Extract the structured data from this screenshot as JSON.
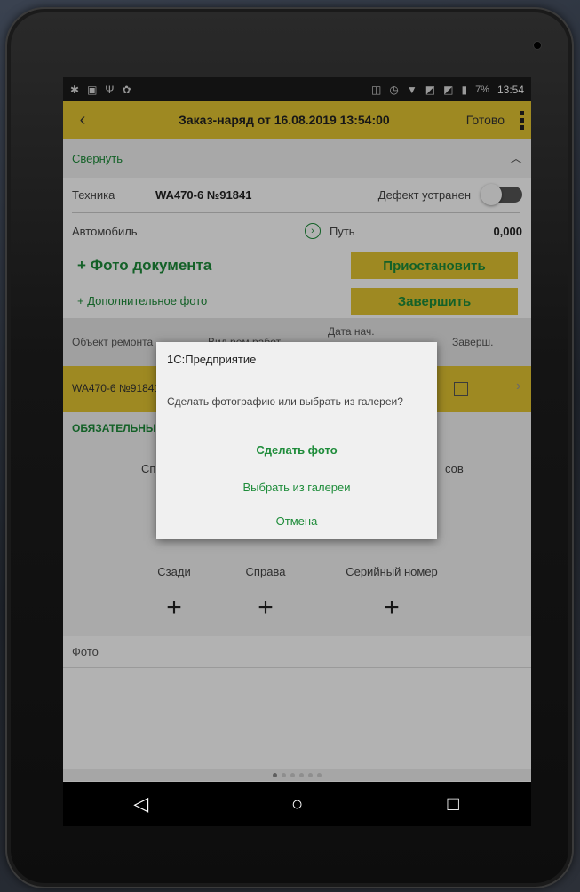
{
  "status_bar": {
    "left_icons": [
      "notification-icon",
      "image-icon",
      "usb-icon",
      "android-debug-icon"
    ],
    "right_icons": [
      "vibrate-icon",
      "alarm-icon",
      "wifi-icon",
      "signal-icon",
      "signal-icon",
      "battery-icon"
    ],
    "battery": "7%",
    "time": "13:54"
  },
  "header": {
    "title": "Заказ-наряд  от 16.08.2019 13:54:00",
    "done_label": "Готово"
  },
  "collapse": {
    "label": "Свернуть"
  },
  "equipment": {
    "label": "Техника",
    "value": "WA470-6 №91841",
    "defect_label": "Дефект устранен"
  },
  "vehicle": {
    "label": "Автомобиль",
    "path_label": "Путь",
    "path_value": "0,000"
  },
  "actions": {
    "doc_photo": "+ Фото документа",
    "extra_photo": "+ Дополнительное фото",
    "pause": "Приостановить",
    "finish": "Завершить"
  },
  "table": {
    "columns": [
      "Объект ремонта",
      "Вид рем.работ",
      "Дата нач.",
      "Заверш."
    ],
    "rows": [
      {
        "object": "WA470-6 №91841",
        "done": false
      }
    ]
  },
  "required": {
    "title": "ОБЯЗАТЕЛЬНЫЕ ФОТО",
    "top_labels": [
      "Сп",
      "сов"
    ],
    "cells": [
      {
        "label": "Сзади",
        "plus": "+"
      },
      {
        "label": "Справа",
        "plus": "+"
      },
      {
        "label": "Серийный номер",
        "plus": "+"
      }
    ]
  },
  "photo_section": {
    "title": "Фото"
  },
  "pager": {
    "count": 6,
    "active": 0
  },
  "dialog": {
    "title": "1С:Предприятие",
    "message": "Сделать фотографию или выбрать из галереи?",
    "take_photo": "Сделать фото",
    "gallery": "Выбрать из галереи",
    "cancel": "Отмена"
  },
  "colors": {
    "accent_yellow": "#e3c532",
    "accent_green": "#1e8c3a"
  }
}
